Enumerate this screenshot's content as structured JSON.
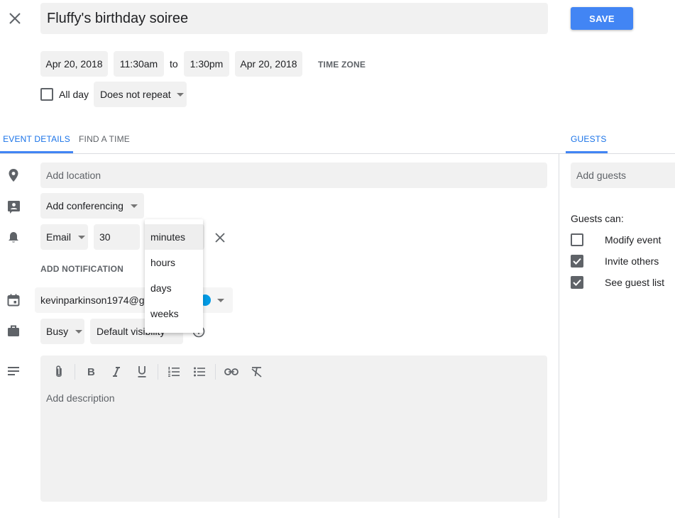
{
  "header": {
    "title": "Fluffy's birthday soiree",
    "save_label": "SAVE"
  },
  "datetime": {
    "start_date": "Apr 20, 2018",
    "start_time": "11:30am",
    "to_label": "to",
    "end_time": "1:30pm",
    "end_date": "Apr 20, 2018",
    "timezone_label": "TIME ZONE",
    "all_day_label": "All day",
    "repeat_value": "Does not repeat"
  },
  "tabs": {
    "event_details": "EVENT DETAILS",
    "find_time": "FIND A TIME",
    "guests": "GUESTS"
  },
  "details": {
    "location_placeholder": "Add location",
    "conferencing_label": "Add conferencing",
    "notification_type": "Email",
    "notification_value": "30",
    "add_notification_label": "ADD NOTIFICATION",
    "calendar_owner": "kevinparkinson1974@gr",
    "busy_value": "Busy",
    "visibility_value": "Default visibility",
    "description_placeholder": "Add description"
  },
  "unit_menu": {
    "options": [
      "minutes",
      "hours",
      "days",
      "weeks"
    ],
    "selected": "minutes"
  },
  "guests": {
    "add_placeholder": "Add guests",
    "can_label": "Guests can:",
    "permissions": [
      {
        "label": "Modify event",
        "checked": false
      },
      {
        "label": "Invite others",
        "checked": true
      },
      {
        "label": "See guest list",
        "checked": true
      }
    ]
  },
  "colors": {
    "accent": "#4285f4",
    "calendar_dot": "#039be5"
  }
}
